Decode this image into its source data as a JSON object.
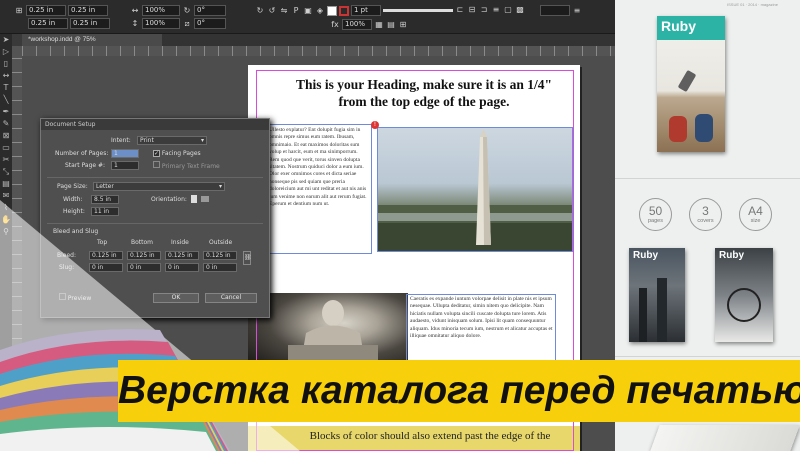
{
  "app": {
    "doc_tab": "*workshop.indd @ 75%",
    "control_fields": [
      "0.25 in",
      "0.25 in",
      "0.25 in",
      "0.25 in",
      "100%",
      "100%",
      "0°",
      "0°",
      "1 pt",
      "100%"
    ]
  },
  "page": {
    "heading_line1": "This is your Heading, make sure it is an 1/4\"",
    "heading_line2": "from the top edge of the page.",
    "col1_text": "Ullesto explatur? Ent dolupit fugia sim in omnis repre simus eum ratem. Ibusam, omnimaio. Et eat maximos doloritas sum volup et harcit, eum et ma sinimporrum. Rem quod que verit, torus sinven dolupta sitatem. Nostrum quiduci dolor a eum ium. Olor exer omnimos cores et dicta seriae nonseque pis sed quiam que preria doloreicium aut mi unt reditat et aut nis anis ium venime non earum alit aut rerum fugiat. Eperum et dentium num ut.",
    "col2_text": "Caeratis es expande iuntum volorpae delisit in plate nis et ipsum nesequae. Ullupta deditatur, simin nitem quo delicipite. Nam hiciatis nullam volupta sincili cuscate dolupta ture lorem. Atis audaesto, vidunt inisquam solum. Ipisi lit quam consequuntur aliquam. Idus minoria tecum ium, nestrum et alicatur accuptas et illiquae omnitatur aliquo dolore.",
    "bottom_text": "Blocks of color should also extend past the edge of the"
  },
  "dialog": {
    "title": "Document Setup",
    "intent_label": "Intent:",
    "intent_value": "Print",
    "pages_label": "Number of Pages:",
    "pages_value": "1",
    "facing_label": "Facing Pages",
    "start_label": "Start Page #:",
    "start_value": "1",
    "primary_frame_label": "Primary Text Frame",
    "size_label": "Page Size:",
    "size_value": "Letter",
    "width_label": "Width:",
    "width_value": "8.5 in",
    "height_label": "Height:",
    "height_value": "11 in",
    "orientation_label": "Orientation:",
    "bleed_section": "Bleed and Slug",
    "col_top": "Top",
    "col_bottom": "Bottom",
    "col_inside": "Inside",
    "col_outside": "Outside",
    "bleed_label": "Bleed:",
    "slug_label": "Slug:",
    "bleed_values": [
      "0.125 in",
      "0.125 in",
      "0.125 in",
      "0.125 in"
    ],
    "slug_values": [
      "0 in",
      "0 in",
      "0 in",
      "0 in"
    ],
    "preview_label": "Preview",
    "ok_label": "OK",
    "cancel_label": "Cancel"
  },
  "promo": {
    "cover_title": "Ruby",
    "cover_top_text": "ISSUE 01 · 2014 · magazine",
    "stats": [
      {
        "n": "50",
        "u": "pages"
      },
      {
        "n": "3",
        "u": "covers"
      },
      {
        "n": "A4",
        "u": "size"
      }
    ]
  },
  "banner": {
    "text": "Верстка каталога перед печатью",
    "color": "#f7cf0b"
  }
}
